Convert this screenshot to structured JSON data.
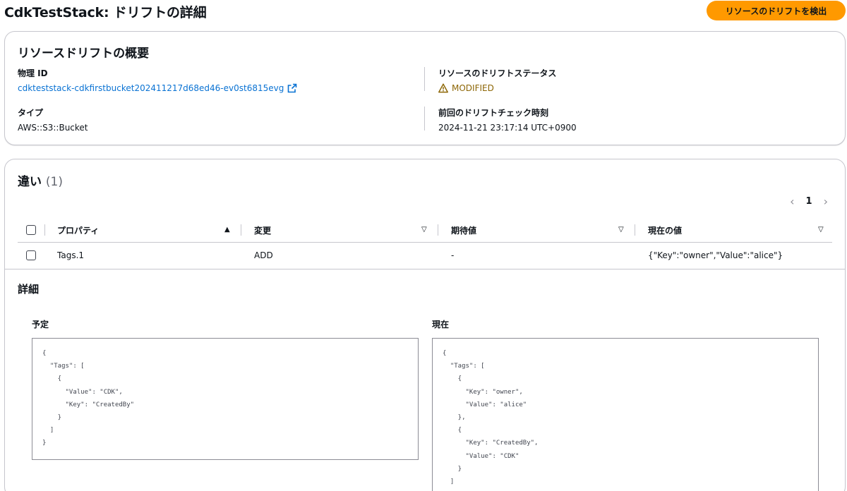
{
  "header": {
    "title": "CdkTestStack: ドリフトの詳細",
    "detect_button": "リソースのドリフトを検出"
  },
  "summary": {
    "title": "リソースドリフトの概要",
    "physical_id_label": "物理 ID",
    "physical_id_value": "cdkteststack-cdkfirstbucket202411217d68ed46-ev0st6815evg",
    "type_label": "タイプ",
    "type_value": "AWS::S3::Bucket",
    "drift_status_label": "リソースのドリフトステータス",
    "drift_status_value": "MODIFIED",
    "last_check_label": "前回のドリフトチェック時刻",
    "last_check_value": "2024-11-21 23:17:14 UTC+0900"
  },
  "differences": {
    "title": "違い",
    "count": "(1)",
    "pagination": {
      "current_page": "1"
    },
    "columns": [
      "プロパティ",
      "変更",
      "期待値",
      "現在の値"
    ],
    "rows": [
      {
        "property": "Tags.1",
        "change": "ADD",
        "expected": "-",
        "actual": "{\"Key\":\"owner\",\"Value\":\"alice\"}"
      }
    ]
  },
  "details": {
    "title": "詳細",
    "expected_label": "予定",
    "actual_label": "現在",
    "expected_json": "{\n  \"Tags\": [\n    {\n      \"Value\": \"CDK\",\n      \"Key\": \"CreatedBy\"\n    }\n  ]\n}",
    "actual_json": "{\n  \"Tags\": [\n    {\n      \"Key\": \"owner\",\n      \"Value\": \"alice\"\n    },\n    {\n      \"Key\": \"CreatedBy\",\n      \"Value\": \"CDK\"\n    }\n  ]\n}"
  },
  "colors": {
    "primary_button": "#ff9900",
    "link": "#0972d3",
    "warning": "#8d6605"
  },
  "icons": {
    "external_link": "external-link-icon",
    "warning": "warning-icon",
    "sort_ascending": "sort-ascending-icon",
    "sort_descending": "sort-descending-icon",
    "chevron_left": "chevron-left-icon",
    "chevron_right": "chevron-right-icon"
  }
}
